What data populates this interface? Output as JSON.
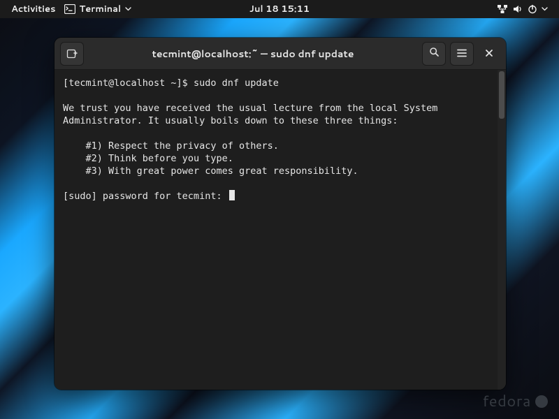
{
  "topbar": {
    "activities": "Activities",
    "app_icon": "terminal-icon",
    "app_name": "Terminal",
    "datetime": "Jul 18  15:11"
  },
  "window": {
    "title": "tecmint@localhost:~ — sudo dnf update"
  },
  "terminal": {
    "prompt": "[tecmint@localhost ~]$ ",
    "command": "sudo dnf update",
    "lecture_line1": "We trust you have received the usual lecture from the local System",
    "lecture_line2": "Administrator. It usually boils down to these three things:",
    "rule1": "    #1) Respect the privacy of others.",
    "rule2": "    #2) Think before you type.",
    "rule3": "    #3) With great power comes great responsibility.",
    "password_prompt": "[sudo] password for tecmint: "
  },
  "watermark": "fedora"
}
